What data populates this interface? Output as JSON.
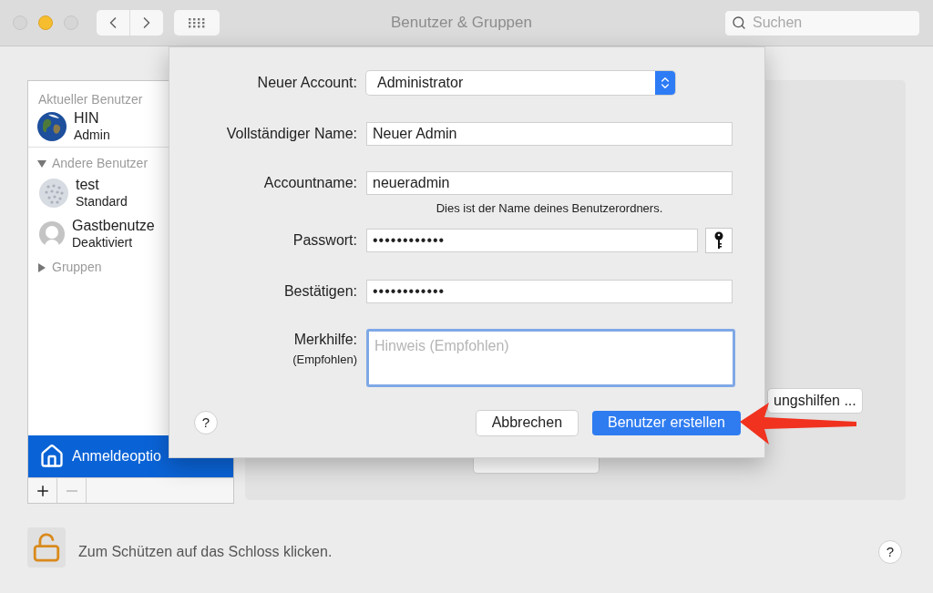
{
  "window": {
    "title": "Benutzer & Gruppen",
    "search": {
      "placeholder": "Suchen"
    }
  },
  "sidebar": {
    "current_header": "Aktueller Benutzer",
    "current_user": {
      "kind": "earth",
      "name": "HIN",
      "role": "Admin"
    },
    "other_header": {
      "label": "Andere Benutzer",
      "expanded": true
    },
    "other_users": [
      {
        "kind": "golf",
        "name": "test",
        "role": "Standard"
      },
      {
        "kind": "guest",
        "name": "Gastbenutze",
        "role": "Deaktiviert"
      }
    ],
    "groups": {
      "label": "Gruppen",
      "expanded": false
    },
    "login_options": {
      "label": "Anmeldeoptio",
      "selected": true
    }
  },
  "panel": {
    "accessibility_button": "ungshilfen ..."
  },
  "lock": {
    "text": "Zum Schützen auf das Schloss klicken.",
    "locked": false
  },
  "help": "?",
  "sheet": {
    "fields": [
      {
        "kind": "popup",
        "label": "Neuer Account:",
        "value": "Administrator"
      },
      {
        "kind": "text",
        "label": "Vollständiger Name:",
        "value": "Neuer Admin"
      },
      {
        "kind": "text",
        "label": "Accountname:",
        "value": "neueradmin",
        "note": "Dies ist der Name deines Benutzerordners."
      },
      {
        "kind": "password",
        "label": "Passwort:",
        "value": "••••••••••••",
        "key_button": true
      },
      {
        "kind": "password",
        "label": "Bestätigen:",
        "value": "••••••••••••"
      },
      {
        "kind": "textarea",
        "label": "Merkhilfe:",
        "sublabel": "(Empfohlen)",
        "placeholder": "Hinweis (Empfohlen)",
        "focused": true
      }
    ],
    "help": "?",
    "buttons": [
      {
        "label": "Abbrechen",
        "default": false
      },
      {
        "label": "Benutzer erstellen",
        "default": true
      }
    ]
  }
}
